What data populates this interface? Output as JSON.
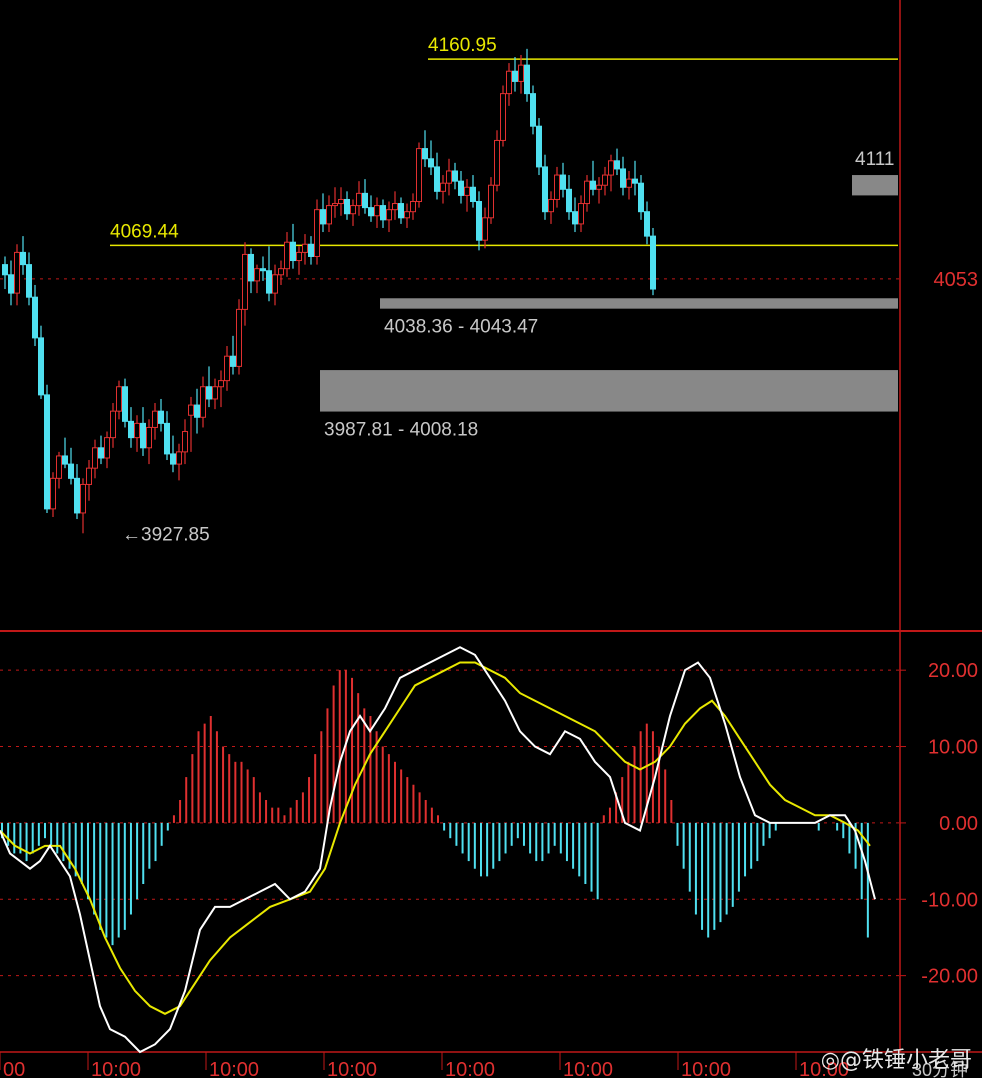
{
  "colors": {
    "background": "#000000",
    "up": "#e03030",
    "down": "#50e0f0",
    "frame": "#c01818",
    "level_line": "#e8e800",
    "zone": "#888888",
    "label_gray": "#c8c8c8",
    "dif_line": "#ffffff",
    "dea_line": "#e8e800"
  },
  "chart_data": [
    {
      "type": "candlestick",
      "ylim": [
        3880,
        4190
      ],
      "bar_count": 148,
      "candles": [
        [
          3986,
          3995,
          3968,
          3991
        ],
        [
          3991,
          3999,
          3977,
          3985
        ],
        [
          3985,
          4005,
          3980,
          4000
        ],
        [
          4000,
          4010,
          3990,
          3994
        ],
        [
          3994,
          4004,
          3989,
          4000
        ],
        [
          4000,
          4008,
          3990,
          4003
        ],
        [
          4003,
          4020,
          3998,
          4015
        ],
        [
          4015,
          4025,
          4006,
          4010
        ],
        [
          4010,
          4043,
          4006,
          4038
        ],
        [
          4038,
          4071,
          4030,
          4065
        ],
        [
          4065,
          4068,
          4046,
          4052
        ],
        [
          4052,
          4060,
          4046,
          4058
        ],
        [
          4058,
          4064,
          4052,
          4057
        ],
        [
          4057,
          4069,
          4042,
          4046
        ],
        [
          4046,
          4060,
          4040,
          4055
        ],
        [
          4055,
          4062,
          4050,
          4058
        ],
        [
          4058,
          4076,
          4054,
          4071
        ],
        [
          4071,
          4080,
          4058,
          4062
        ],
        [
          4062,
          4069,
          4055,
          4066
        ],
        [
          4066,
          4075,
          4060,
          4070
        ],
        [
          4070,
          4074,
          4060,
          4064
        ],
        [
          4064,
          4092,
          4060,
          4087
        ],
        [
          4087,
          4095,
          4076,
          4080
        ],
        [
          4080,
          4094,
          4076,
          4089
        ],
        [
          4089,
          4098,
          4083,
          4090
        ],
        [
          4090,
          4098,
          4084,
          4092
        ],
        [
          4092,
          4096,
          4082,
          4085
        ],
        [
          4085,
          4092,
          4079,
          4089
        ],
        [
          4089,
          4101,
          4084,
          4095
        ],
        [
          4095,
          4102,
          4085,
          4088
        ],
        [
          4088,
          4094,
          4081,
          4084
        ],
        [
          4084,
          4093,
          4078,
          4089
        ],
        [
          4089,
          4092,
          4078,
          4082
        ],
        [
          4082,
          4091,
          4076,
          4087
        ],
        [
          4087,
          4096,
          4082,
          4090
        ],
        [
          4090,
          4093,
          4080,
          4083
        ],
        [
          4083,
          4090,
          4078,
          4086
        ],
        [
          4086,
          4095,
          4082,
          4091
        ],
        [
          4091,
          4120,
          4088,
          4117
        ],
        [
          4117,
          4126,
          4108,
          4112
        ],
        [
          4112,
          4121,
          4104,
          4108
        ],
        [
          4108,
          4115,
          4092,
          4096
        ],
        [
          4096,
          4104,
          4090,
          4100
        ],
        [
          4100,
          4112,
          4094,
          4106
        ],
        [
          4106,
          4110,
          4097,
          4101
        ],
        [
          4101,
          4106,
          4090,
          4094
        ],
        [
          4094,
          4102,
          4086,
          4098
        ],
        [
          4098,
          4104,
          4088,
          4091
        ],
        [
          4091,
          4096,
          4067,
          4072
        ],
        [
          4072,
          4088,
          4068,
          4083
        ],
        [
          4083,
          4103,
          4080,
          4099
        ],
        [
          4099,
          4126,
          4096,
          4121
        ],
        [
          4121,
          4148,
          4118,
          4144
        ],
        [
          4144,
          4159,
          4138,
          4155
        ],
        [
          4155,
          4162,
          4145,
          4150
        ],
        [
          4150,
          4163,
          4144,
          4158
        ],
        [
          4158,
          4166,
          4140,
          4144
        ],
        [
          4144,
          4148,
          4124,
          4128
        ],
        [
          4128,
          4132,
          4104,
          4108
        ],
        [
          4108,
          4114,
          4082,
          4086
        ],
        [
          4086,
          4096,
          4080,
          4092
        ],
        [
          4092,
          4108,
          4088,
          4104
        ],
        [
          4104,
          4110,
          4093,
          4097
        ],
        [
          4097,
          4104,
          4082,
          4086
        ],
        [
          4086,
          4093,
          4076,
          4080
        ],
        [
          4080,
          4094,
          4076,
          4090
        ],
        [
          4090,
          4104,
          4086,
          4101
        ],
        [
          4101,
          4111,
          4094,
          4097
        ],
        [
          4097,
          4103,
          4090,
          4099
        ],
        [
          4099,
          4108,
          4094,
          4104
        ],
        [
          4104,
          4114,
          4096,
          4111
        ],
        [
          4111,
          4117,
          4104,
          4107
        ],
        [
          4107,
          4113,
          4094,
          4098
        ],
        [
          4098,
          4106,
          4092,
          4102
        ],
        [
          4102,
          4111,
          4094,
          4100
        ],
        [
          4100,
          4104,
          4082,
          4086
        ],
        [
          4086,
          4091,
          4070,
          4074
        ],
        [
          4074,
          4078,
          4045,
          4048
        ]
      ],
      "levels": [
        {
          "value": 4160.95,
          "label": "4160.95"
        },
        {
          "value": 4069.44,
          "label": "4069.44"
        }
      ],
      "zones": [
        {
          "low": 4038.36,
          "high": 4043.47,
          "label": "4038.36 - 4043.47"
        },
        {
          "low": 3987.81,
          "high": 4008.18,
          "label": "3987.81 - 4008.18"
        },
        {
          "low": 4094,
          "high": 4104,
          "label": "4111"
        }
      ],
      "current_price": {
        "value": 4053,
        "label": "4053"
      },
      "low_marker": {
        "value": 3927.85,
        "label": "3927.85",
        "arrow": "←"
      }
    },
    {
      "type": "macd",
      "ylim": [
        -30,
        25
      ],
      "y_ticks": [
        20,
        10,
        0,
        -10,
        -20
      ],
      "y_tick_labels": [
        "20.00",
        "10.00",
        "0.00",
        "-10.00",
        "-20.00"
      ],
      "histogram": [
        -2,
        -3,
        -4,
        -4,
        -5,
        -4,
        -3,
        -2,
        -3,
        -4,
        -5,
        -6,
        -7,
        -8,
        -10,
        -12,
        -14,
        -15,
        -16,
        -15,
        -14,
        -12,
        -10,
        -8,
        -6,
        -5,
        -3,
        -1,
        1,
        3,
        6,
        9,
        12,
        13,
        14,
        12,
        10,
        9,
        8,
        8,
        7,
        6,
        4,
        3,
        2,
        2,
        1,
        2,
        3,
        4,
        6,
        9,
        12,
        15,
        18,
        20,
        20,
        19,
        17,
        15,
        14,
        12,
        10,
        9,
        8,
        7,
        6,
        5,
        4,
        3,
        2,
        1,
        -1,
        -2,
        -3,
        -4,
        -5,
        -6,
        -7,
        -7,
        -6,
        -5,
        -4,
        -3,
        -2,
        -3,
        -4,
        -5,
        -5,
        -4,
        -3,
        -4,
        -5,
        -6,
        -7,
        -8,
        -9,
        -10,
        1,
        2,
        4,
        6,
        8,
        10,
        12,
        13,
        12,
        10,
        7,
        3,
        -3,
        -6,
        -9,
        -12,
        -14,
        -15,
        -14,
        -13,
        -12,
        -11,
        -9,
        -7,
        -6,
        -5,
        -3,
        -2,
        -1,
        0,
        0,
        0,
        0,
        0,
        0,
        -1,
        0,
        0,
        -1,
        -2,
        -4,
        -6,
        -10,
        -15
      ],
      "dif": [
        [
          0,
          -1
        ],
        [
          10,
          -4
        ],
        [
          20,
          -5
        ],
        [
          30,
          -6
        ],
        [
          40,
          -5
        ],
        [
          50,
          -3
        ],
        [
          60,
          -5
        ],
        [
          70,
          -7
        ],
        [
          80,
          -12
        ],
        [
          90,
          -18
        ],
        [
          100,
          -24
        ],
        [
          110,
          -27
        ],
        [
          125,
          -28
        ],
        [
          140,
          -30
        ],
        [
          155,
          -29
        ],
        [
          170,
          -27
        ],
        [
          185,
          -22
        ],
        [
          200,
          -14
        ],
        [
          215,
          -11
        ],
        [
          230,
          -11
        ],
        [
          245,
          -10
        ],
        [
          260,
          -9
        ],
        [
          275,
          -8
        ],
        [
          290,
          -10
        ],
        [
          305,
          -9
        ],
        [
          320,
          -6
        ],
        [
          330,
          2
        ],
        [
          340,
          8
        ],
        [
          350,
          12
        ],
        [
          360,
          14
        ],
        [
          370,
          12
        ],
        [
          385,
          15
        ],
        [
          400,
          19
        ],
        [
          415,
          20
        ],
        [
          430,
          21
        ],
        [
          445,
          22
        ],
        [
          460,
          23
        ],
        [
          475,
          22
        ],
        [
          490,
          19
        ],
        [
          505,
          16
        ],
        [
          520,
          12
        ],
        [
          535,
          10
        ],
        [
          550,
          9
        ],
        [
          565,
          12
        ],
        [
          580,
          11
        ],
        [
          595,
          8
        ],
        [
          610,
          6
        ],
        [
          625,
          0
        ],
        [
          640,
          -1
        ],
        [
          655,
          6
        ],
        [
          670,
          14
        ],
        [
          685,
          20
        ],
        [
          698,
          21
        ],
        [
          710,
          19
        ],
        [
          725,
          13
        ],
        [
          740,
          6
        ],
        [
          755,
          1
        ],
        [
          770,
          0
        ],
        [
          785,
          0
        ],
        [
          800,
          0
        ],
        [
          815,
          0
        ],
        [
          830,
          1
        ],
        [
          845,
          1
        ],
        [
          855,
          -1
        ],
        [
          865,
          -5
        ],
        [
          875,
          -10
        ]
      ],
      "dea": [
        [
          0,
          -1
        ],
        [
          15,
          -3
        ],
        [
          30,
          -4
        ],
        [
          45,
          -3
        ],
        [
          60,
          -3
        ],
        [
          75,
          -6
        ],
        [
          90,
          -10
        ],
        [
          105,
          -15
        ],
        [
          120,
          -19
        ],
        [
          135,
          -22
        ],
        [
          150,
          -24
        ],
        [
          165,
          -25
        ],
        [
          180,
          -24
        ],
        [
          195,
          -21
        ],
        [
          210,
          -18
        ],
        [
          230,
          -15
        ],
        [
          250,
          -13
        ],
        [
          270,
          -11
        ],
        [
          290,
          -10
        ],
        [
          310,
          -9
        ],
        [
          325,
          -6
        ],
        [
          340,
          0
        ],
        [
          355,
          5
        ],
        [
          370,
          9
        ],
        [
          385,
          12
        ],
        [
          400,
          15
        ],
        [
          415,
          18
        ],
        [
          430,
          19
        ],
        [
          445,
          20
        ],
        [
          460,
          21
        ],
        [
          475,
          21
        ],
        [
          490,
          20
        ],
        [
          505,
          19
        ],
        [
          520,
          17
        ],
        [
          535,
          16
        ],
        [
          550,
          15
        ],
        [
          565,
          14
        ],
        [
          580,
          13
        ],
        [
          595,
          12
        ],
        [
          610,
          10
        ],
        [
          625,
          8
        ],
        [
          640,
          7
        ],
        [
          655,
          8
        ],
        [
          670,
          10
        ],
        [
          685,
          13
        ],
        [
          700,
          15
        ],
        [
          712,
          16
        ],
        [
          725,
          14
        ],
        [
          740,
          11
        ],
        [
          755,
          8
        ],
        [
          770,
          5
        ],
        [
          785,
          3
        ],
        [
          800,
          2
        ],
        [
          815,
          1
        ],
        [
          830,
          1
        ],
        [
          845,
          0
        ],
        [
          858,
          -1
        ],
        [
          870,
          -3
        ]
      ]
    }
  ],
  "x_axis_labels": [
    "00",
    "10:00",
    "10:00",
    "10:00",
    "10:00",
    "10:00",
    "10:00",
    "10:00"
  ],
  "period_label": "30分钟",
  "watermark": "@铁锤小老哥"
}
